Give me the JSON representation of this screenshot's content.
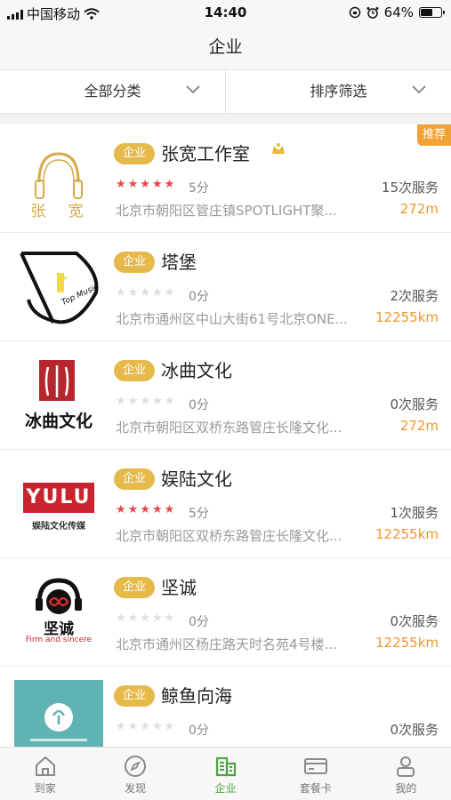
{
  "status_bar": {
    "carrier": "中国移动",
    "time": "14:40",
    "battery": "64%",
    "battery_level": 0.64
  },
  "header": {
    "title": "企业"
  },
  "filters": [
    {
      "label": "全部分类"
    },
    {
      "label": "排序筛选"
    }
  ],
  "tag_label": "企业",
  "recommend_badge": "推荐",
  "companies": [
    {
      "name": "张宽工作室",
      "rating": 5,
      "score": "5分",
      "services": "15次服务",
      "address": "北京市朝阳区管庄镇SPOTLIGHT聚...",
      "distance": "272m",
      "recommended": true,
      "logo_text": "张　宽"
    },
    {
      "name": "塔堡",
      "rating": 0,
      "score": "0分",
      "services": "2次服务",
      "address": "北京市通州区中山大街61号北京ONE...",
      "distance": "12255km",
      "logo_text": "Top Music"
    },
    {
      "name": "冰曲文化",
      "rating": 0,
      "score": "0分",
      "services": "0次服务",
      "address": "北京市朝阳区双桥东路管庄长隆文化...",
      "distance": "272m",
      "logo_text": "冰曲文化"
    },
    {
      "name": "娱陆文化",
      "rating": 5,
      "score": "5分",
      "services": "1次服务",
      "address": "北京市朝阳区双桥东路管庄长隆文化...",
      "distance": "12255km",
      "logo_text": "YULU",
      "logo_sub": "娱陆文化传媒"
    },
    {
      "name": "坚诚",
      "rating": 0,
      "score": "0分",
      "services": "0次服务",
      "address": "北京市通州区杨庄路天时名苑4号楼...",
      "distance": "12255km",
      "logo_text": "坚诚",
      "logo_sub": "Firm and sincere"
    },
    {
      "name": "鲸鱼向海",
      "rating": 0,
      "score": "0分",
      "services": "0次服务",
      "address": "",
      "distance": ""
    }
  ],
  "tabs": [
    {
      "label": "到家",
      "icon": "home-icon"
    },
    {
      "label": "发现",
      "icon": "compass-icon"
    },
    {
      "label": "企业",
      "icon": "building-icon",
      "active": true
    },
    {
      "label": "套餐卡",
      "icon": "card-icon"
    },
    {
      "label": "我的",
      "icon": "person-icon"
    }
  ],
  "colors": {
    "accent_orange": "#f0962a",
    "tag_gold": "#e5b94a",
    "star_red": "#e8474c",
    "tab_active_green": "#4aa53a"
  }
}
